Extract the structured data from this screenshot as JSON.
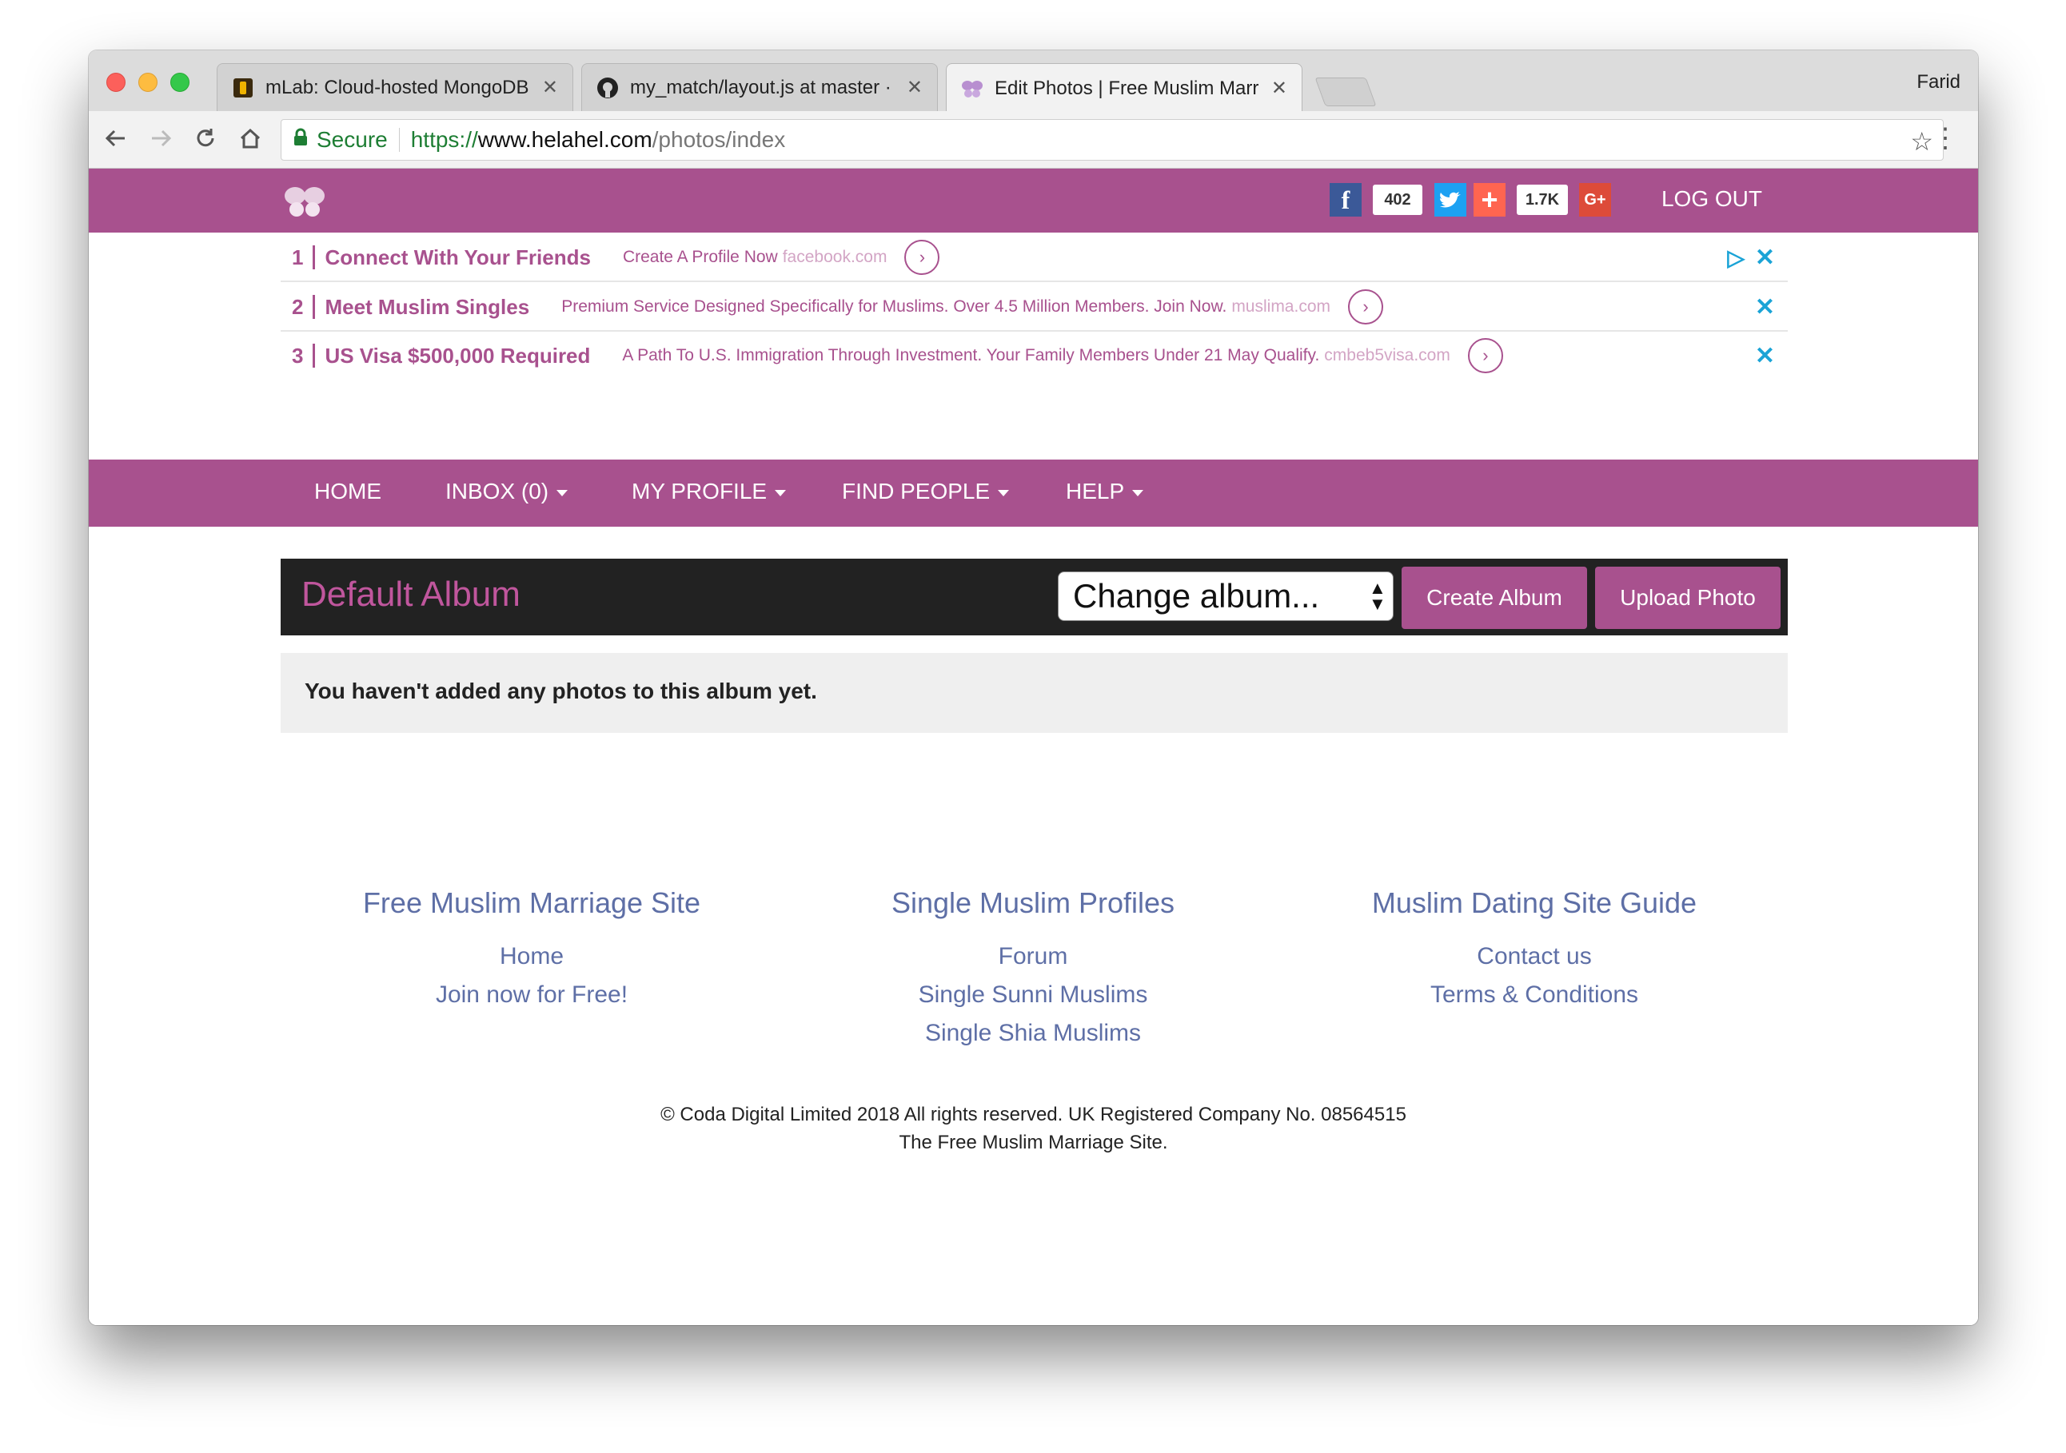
{
  "browser": {
    "profile_name": "Farid",
    "tabs": [
      {
        "title": "mLab: Cloud-hosted MongoDB",
        "icon": "mlab-icon"
      },
      {
        "title": "my_match/layout.js at master ·",
        "icon": "github-icon"
      },
      {
        "title": "Edit Photos | Free Muslim Marr",
        "icon": "butterfly-icon"
      }
    ],
    "url_secure_label": "Secure",
    "url_scheme": "https://",
    "url_host": "www.helahel.com",
    "url_path": "/photos/index"
  },
  "topbar": {
    "facebook_count": "402",
    "share_count": "1.7K",
    "facebook_glyph": "f",
    "plus_glyph": "+",
    "gplus_glyph": "G+",
    "logout_label": "LOG OUT"
  },
  "ads": [
    {
      "num": "1",
      "title": "Connect With Your Friends",
      "text": "Create A Profile Now",
      "domain": "facebook.com"
    },
    {
      "num": "2",
      "title": "Meet Muslim Singles",
      "text": "Premium Service Designed Specifically for Muslims. Over 4.5 Million Members. Join Now.",
      "domain": "muslima.com"
    },
    {
      "num": "3",
      "title": "US Visa $500,000 Required",
      "text": "A Path To U.S. Immigration Through Investment. Your Family Members Under 21 May Qualify.",
      "domain": "cmbeb5visa.com"
    }
  ],
  "nav": {
    "home": "HOME",
    "inbox": "INBOX (0)",
    "my_profile": "MY PROFILE",
    "find_people": "FIND PEOPLE",
    "help": "HELP"
  },
  "album": {
    "title": "Default Album",
    "select_value": "Change album...",
    "create_label": "Create Album",
    "upload_label": "Upload Photo",
    "empty_message": "You haven't added any photos to this album yet."
  },
  "footer": {
    "col1": {
      "heading": "Free Muslim Marriage Site",
      "links": [
        "Home",
        "Join now for Free!"
      ]
    },
    "col2": {
      "heading": "Single Muslim Profiles",
      "links": [
        "Forum",
        "Single Sunni Muslims",
        "Single Shia Muslims"
      ]
    },
    "col3": {
      "heading": "Muslim Dating Site Guide",
      "links": [
        "Contact us",
        "Terms & Conditions"
      ]
    },
    "copyright_line1": "© Coda Digital Limited 2018 All rights reserved. UK Registered Company No. 08564515",
    "copyright_line2": "The Free Muslim Marriage Site."
  },
  "colors": {
    "brand": "#a8518e",
    "footer_link": "#5e6fa6",
    "secure_green": "#1e7e34"
  }
}
